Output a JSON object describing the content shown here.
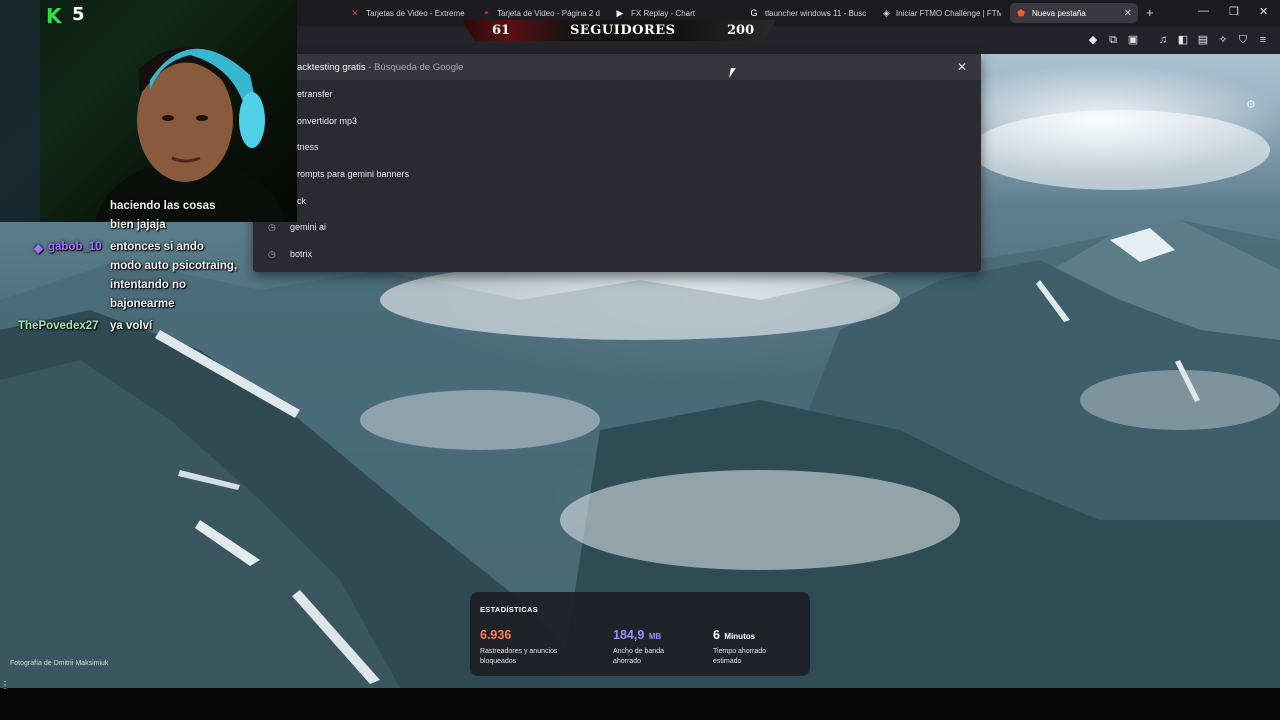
{
  "tabs": [
    {
      "label": "Tarjetas de Video - Extreme",
      "icon": "x-brand-icon"
    },
    {
      "label": "Tarjeta de Video - Página 2 d",
      "icon": "red-swirl-icon"
    },
    {
      "label": "FX Replay - Chart",
      "icon": "play-logo-icon"
    },
    {
      "label": "tlauncher windows 11 - Busc",
      "icon": "google-icon"
    },
    {
      "label": "Iniciar FTMO Challenge | FTM",
      "icon": "ftmo-icon"
    },
    {
      "label": "Nueva pestaña",
      "icon": "brave-icon"
    }
  ],
  "followers": {
    "current": "61",
    "label": "SEGUIDORES",
    "goal": "200"
  },
  "webcam": {
    "platform_logo": "K",
    "count": "5"
  },
  "omnibox": {
    "typed": "acktesting gratis",
    "suffix": " - Búsqueda de Google",
    "suggestions": [
      {
        "icon": "history-icon",
        "text": "etransfer"
      },
      {
        "icon": "history-icon",
        "text": "onvertidor mp3"
      },
      {
        "icon": "history-icon",
        "text": "tness"
      },
      {
        "icon": "history-icon",
        "text": "rompts para gemini banners"
      },
      {
        "icon": "history-icon",
        "text": "ck"
      },
      {
        "icon": "history-icon",
        "text": "gemini ai"
      },
      {
        "icon": "history-icon",
        "text": "botrix"
      }
    ]
  },
  "chat": {
    "line1_msg": "haciendo las cosas",
    "line2_msg": "bien jajaja",
    "user2": "gabob_10",
    "line3_msg": "entonces si ando",
    "line4_msg": "modo auto psicotraing,",
    "line5_msg": "intentando no",
    "line6_msg": "bajonearme",
    "user3": "ThePovedex27",
    "line7_msg": "ya volví"
  },
  "stats": {
    "title": "ESTADÍSTICAS",
    "blocked_value": "6.936",
    "blocked_label": "Rastreadores y anuncios bloqueados",
    "bandwidth_value": "184,9",
    "bandwidth_unit": "MB",
    "bandwidth_label": "Ancho de banda ahorrado",
    "time_value": "6",
    "time_unit": "Minutos",
    "time_label": "Tiempo ahorrado estimado",
    "colors": {
      "blocked": "#ff7a4a",
      "bandwidth": "#a08cff",
      "time": "#ffffff"
    }
  },
  "photo_credit": "Fotografía de Dmitrii Maksimiuk"
}
